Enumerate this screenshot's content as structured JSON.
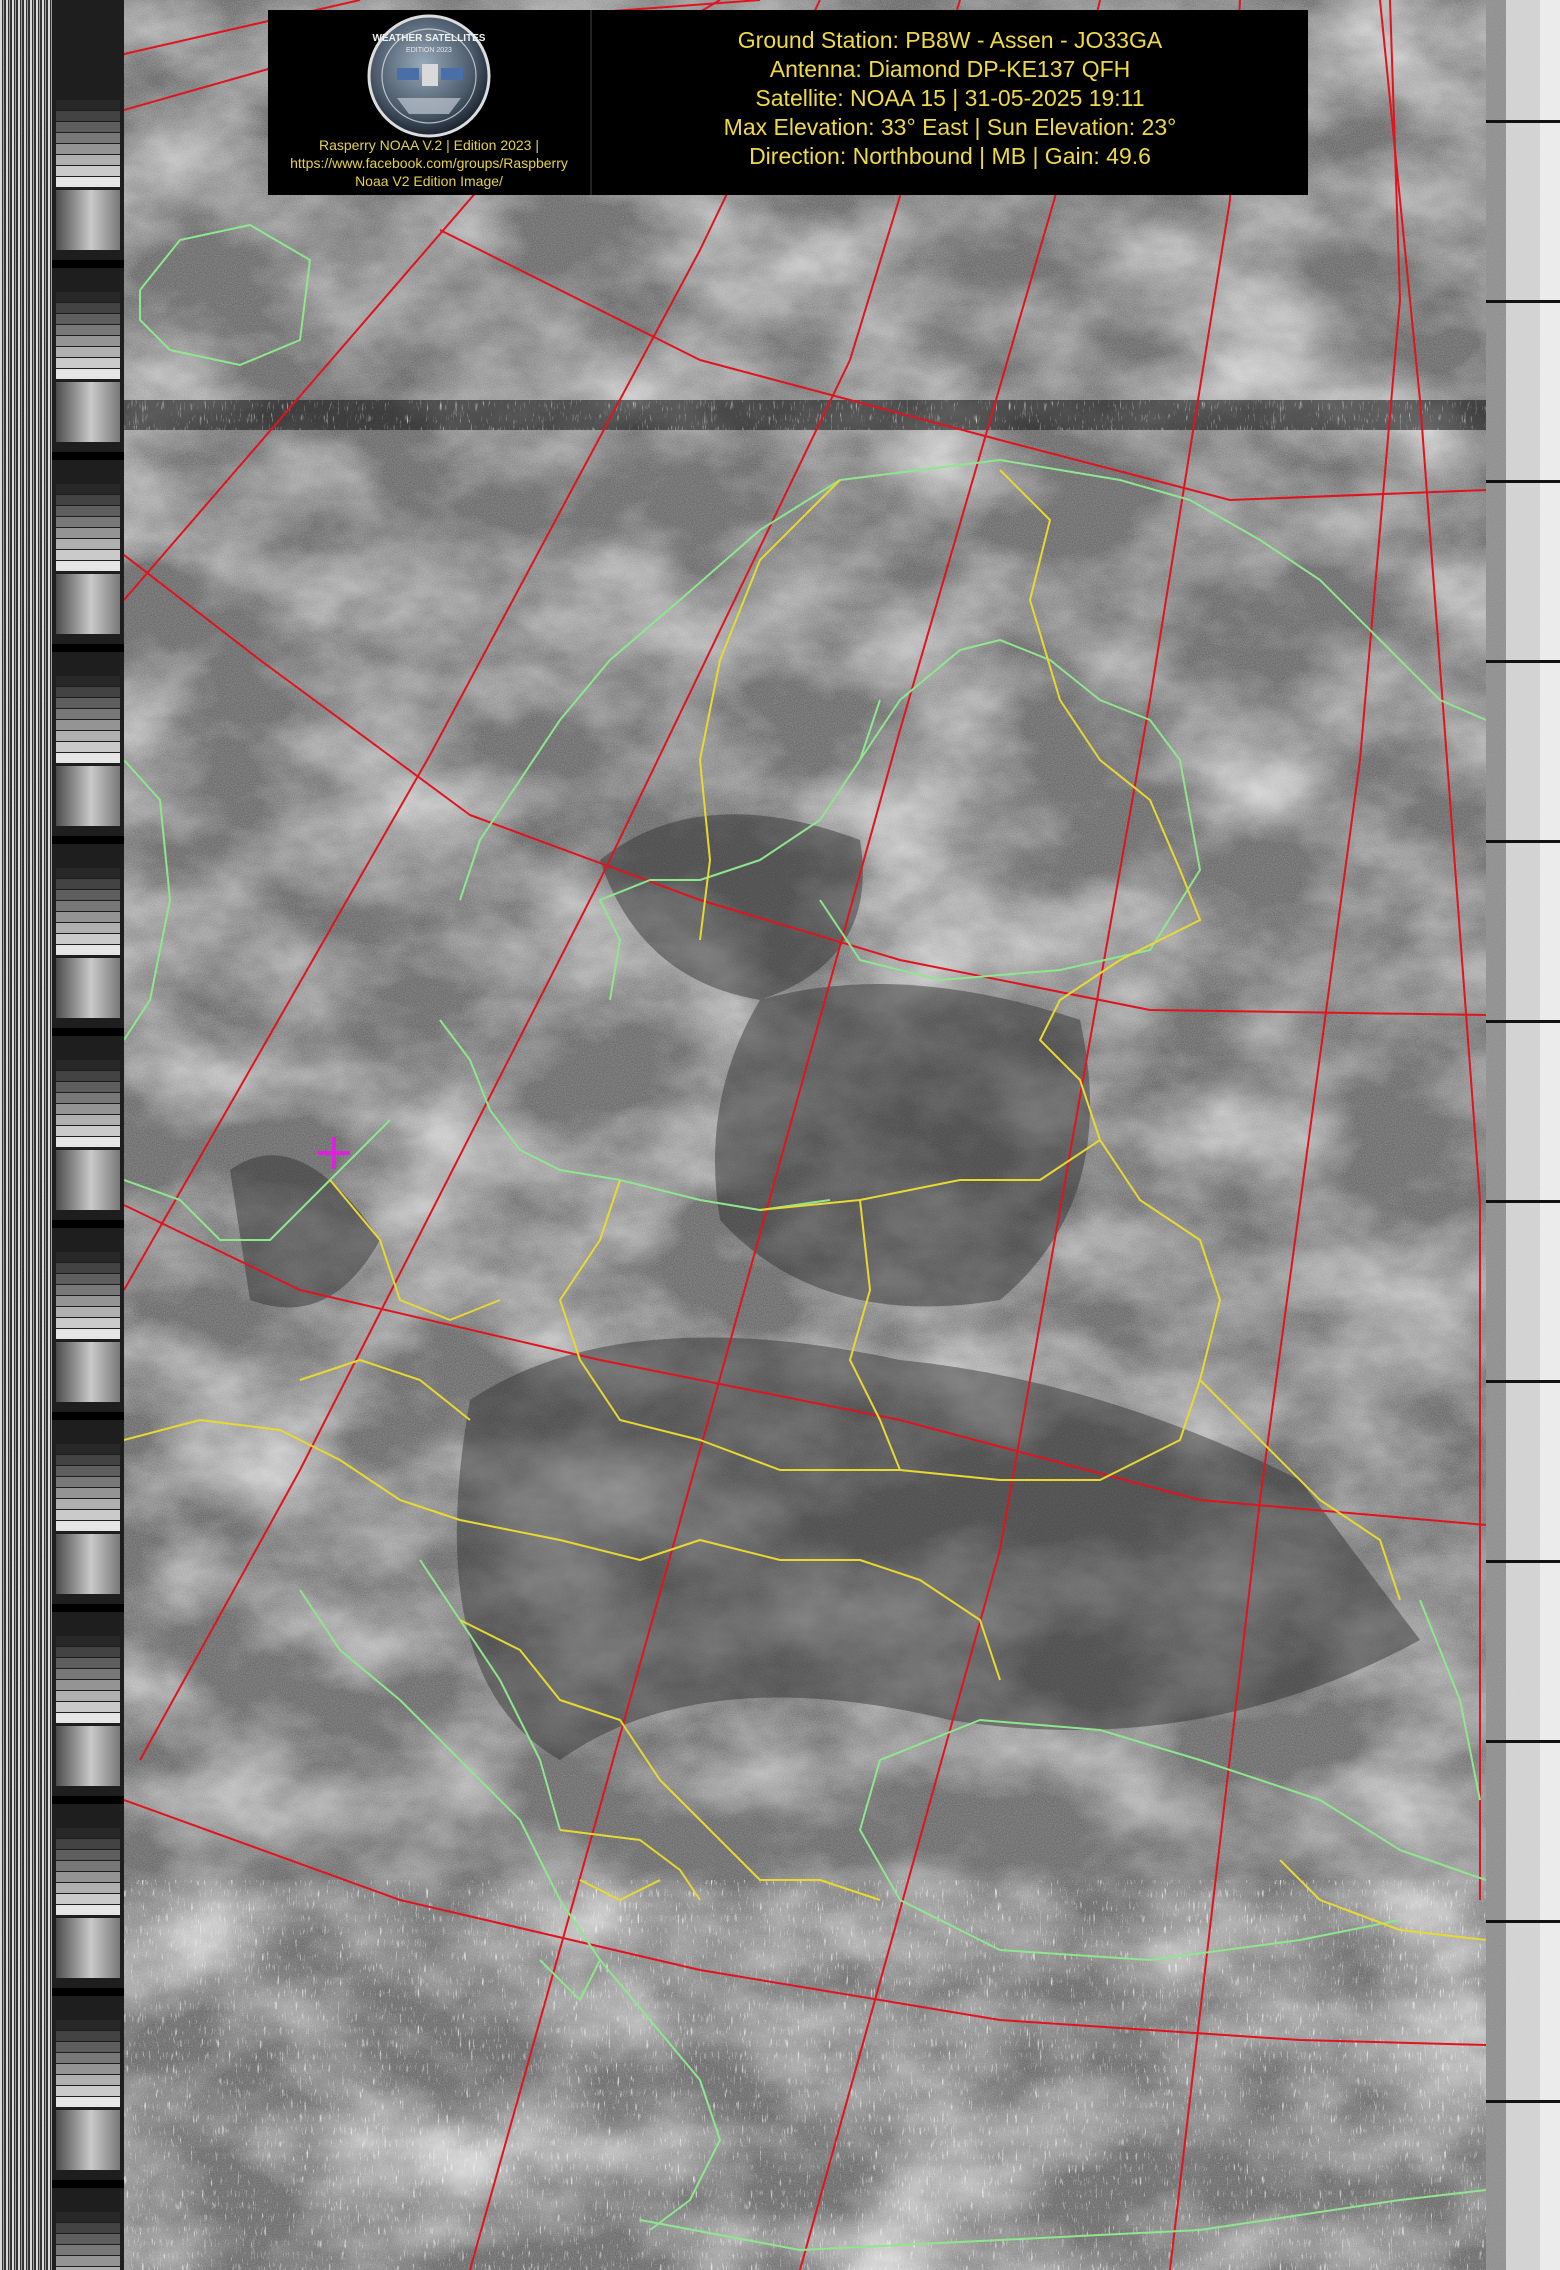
{
  "header": {
    "logo": {
      "badge_text": "WEATHER SATELLITES",
      "badge_subtext": "EDITION 2023",
      "caption_lines": [
        "Rasperry NOAA V.2 | Edition 2023 |",
        "https://www.facebook.com/groups/Raspberry",
        "Noaa V2 Edition Image/"
      ]
    },
    "info_lines": [
      "Ground Station: PB8W - Assen - JO33GA",
      "Antenna: Diamond DP-KE137 QFH",
      "Satellite: NOAA 15 | 31-05-2025 19:11",
      "Max Elevation: 33° East | Sun Elevation: 23°",
      "Direction: Northbound | MB | Gain: 49.6"
    ]
  },
  "map": {
    "colors": {
      "graticule": "#e0141e",
      "coastline": "#8ee68e",
      "borders": "#e8d832",
      "station_marker": "#e020e0",
      "header_text": "#f0d948"
    },
    "station_marker_icon": "crosshair-plus"
  }
}
